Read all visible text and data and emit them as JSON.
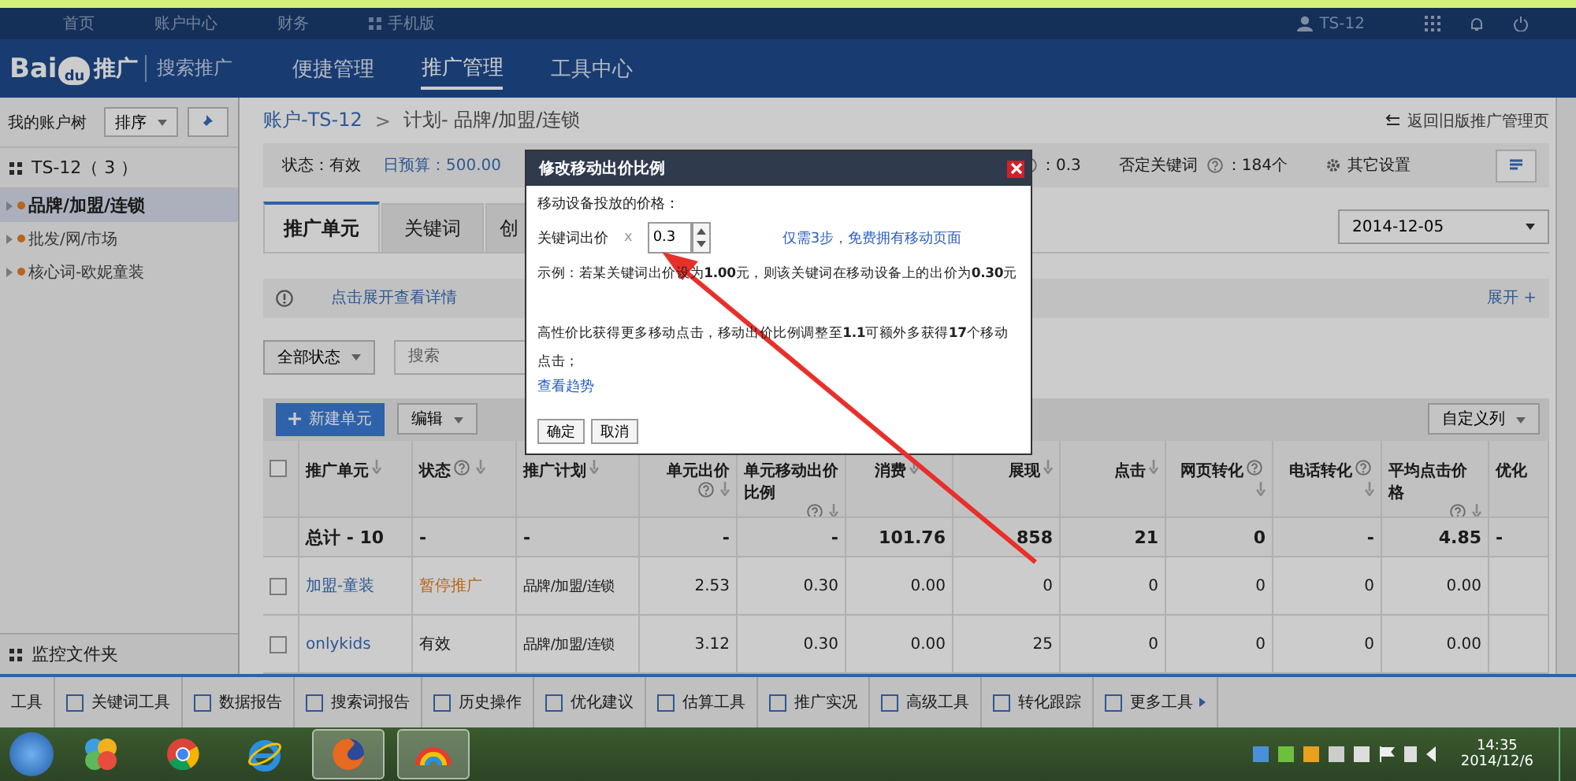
{
  "top_nav": {
    "links": [
      "首页",
      "账户中心",
      "财务",
      "手机版"
    ],
    "user": "TS-12"
  },
  "header": {
    "logo": {
      "left": "Bai",
      "paw": "du",
      "right": "推广"
    },
    "product": "搜索推广",
    "menu": [
      {
        "label": "便捷管理",
        "selected": false
      },
      {
        "label": "推广管理",
        "selected": true
      },
      {
        "label": "工具中心",
        "selected": false
      }
    ]
  },
  "sidebar": {
    "title": "我的账户树",
    "sort": "排序",
    "account": "TS-12（ 3 ）",
    "plans": [
      {
        "label": "品牌/加盟/连锁",
        "selected": true
      },
      {
        "label": "批发/网/市场",
        "selected": false
      },
      {
        "label": "核心词-欧妮童装",
        "selected": false
      }
    ],
    "footer": "监控文件夹"
  },
  "breadcrumb": {
    "account": "账户-TS-12",
    "separator": ">",
    "plan": "计划- 品牌/加盟/连锁"
  },
  "back_link": "返回旧版推广管理页",
  "summary": {
    "status": "状态：有效",
    "budget": "日预算：500.00",
    "mobile_ratio": "：0.3",
    "negative_label": "否定关键词",
    "negative_value": "：184个",
    "other_settings": "其它设置"
  },
  "tabs": [
    {
      "label": "推广单元",
      "selected": true
    },
    {
      "label": "关键词",
      "selected": false
    },
    {
      "label": "创",
      "selected": false
    }
  ],
  "date": "2014-12-05",
  "notice": {
    "text": "点击展开查看详情",
    "expand": "展开 +"
  },
  "filter": {
    "status": "全部状态",
    "search_placeholder": "搜索"
  },
  "toolbar": {
    "new": "新建单元",
    "edit": "编辑",
    "columns": "自定义列"
  },
  "table": {
    "all_checked": false,
    "columns": [
      {
        "label": "推广单元",
        "help": false,
        "sortable": true
      },
      {
        "label": "状态",
        "help": true,
        "sortable": true
      },
      {
        "label": "推广计划",
        "help": false,
        "sortable": true
      },
      {
        "label": "单元出价",
        "help": true,
        "sortable": true
      },
      {
        "label": "单元移动出价比例",
        "help": true,
        "sortable": true
      },
      {
        "label": "消费",
        "help": false,
        "sortable": true
      },
      {
        "label": "展现",
        "help": false,
        "sortable": true
      },
      {
        "label": "点击",
        "help": false,
        "sortable": true
      },
      {
        "label": "网页转化",
        "help": true,
        "sortable": true
      },
      {
        "label": "电话转化",
        "help": true,
        "sortable": true
      },
      {
        "label": "平均点击价格",
        "help": true,
        "sortable": true
      },
      {
        "label": "优化",
        "help": false,
        "sortable": false
      }
    ],
    "total": [
      "总计 - 10",
      "-",
      "-",
      "-",
      "-",
      "101.76",
      "858",
      "21",
      "0",
      "-",
      "4.85",
      "-"
    ],
    "rows": [
      {
        "paused": true,
        "checked": false,
        "cells": [
          "加盟-童装",
          "暂停推广",
          "品牌/加盟/连锁",
          "2.53",
          "0.30",
          "0.00",
          "0",
          "0",
          "0",
          "0",
          "0.00"
        ]
      },
      {
        "paused": false,
        "checked": false,
        "cells": [
          "onlykids",
          "有效",
          "品牌/加盟/连锁",
          "3.12",
          "0.30",
          "0.00",
          "25",
          "0",
          "0",
          "0",
          "0.00"
        ]
      }
    ]
  },
  "modal": {
    "title": "修改移动出价比例",
    "label": "移动设备投放的价格：",
    "bid_label": "关键词出价",
    "times": "x",
    "value": "0.3",
    "promo": "仅需3步，免费拥有移动页面",
    "example": "示例：若某关键词出价设为**1.00**元，则该关键词在移动设备上的出价为**0.30**元",
    "tip": "高性价比获得更多移动点击，移动出价比例调整至**1.1**可额外多获得**17**个移动点击；",
    "link": "查看趋势",
    "buttons": [
      "确定",
      "取消"
    ]
  },
  "tools": [
    "工具",
    "关键词工具",
    "数据报告",
    "搜索词报告",
    "历史操作",
    "优化建议",
    "估算工具",
    "推广实况",
    "高级工具",
    "转化跟踪",
    "更多工具"
  ],
  "taskbar": {
    "apps": [
      {
        "kind": "pinwheel",
        "selected": false
      },
      {
        "kind": "chrome",
        "selected": false
      },
      {
        "kind": "ie",
        "selected": false
      },
      {
        "kind": "firefox",
        "selected": true
      },
      {
        "kind": "rainbow",
        "selected": true
      }
    ],
    "time": "14:35",
    "date": "2014/12/6"
  }
}
